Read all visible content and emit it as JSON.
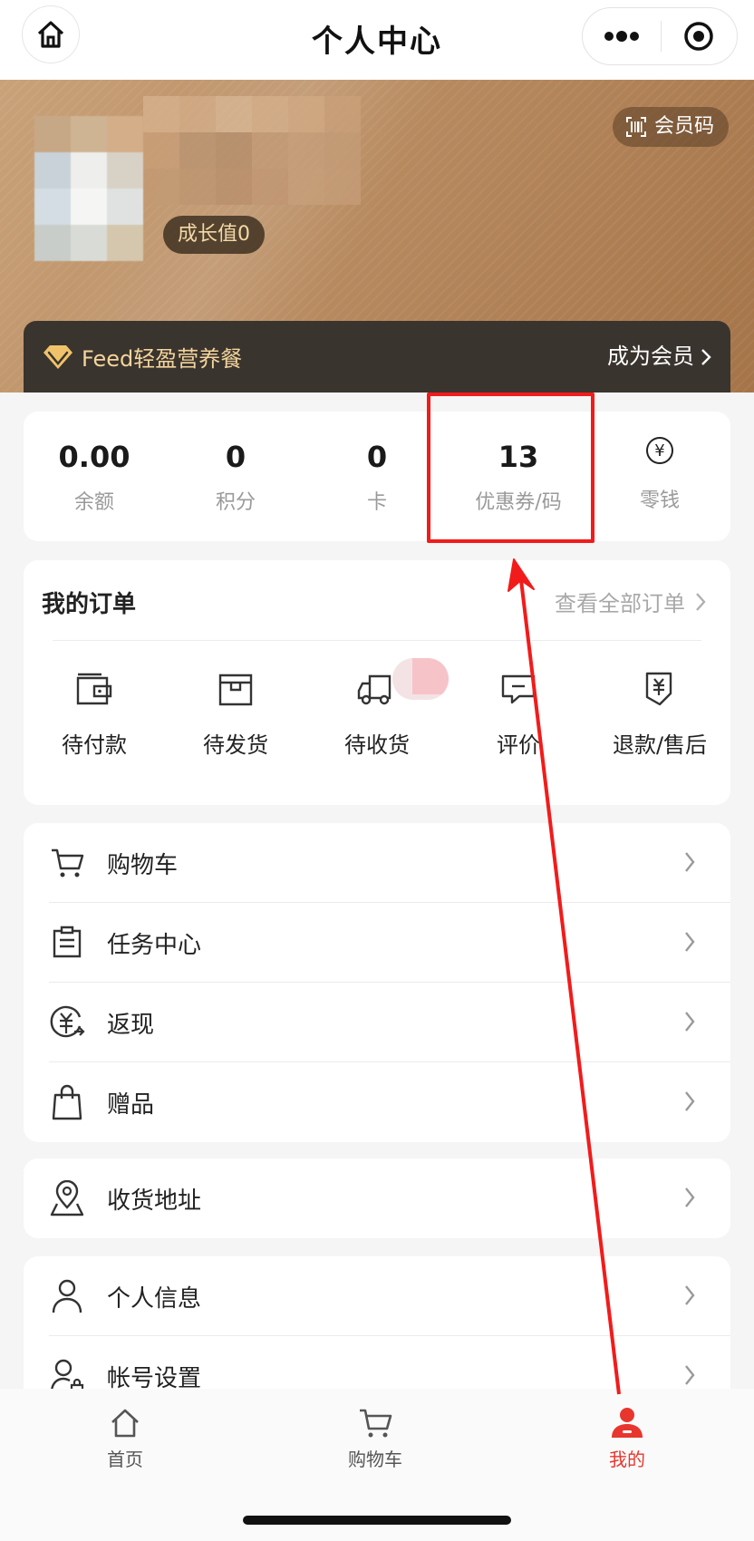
{
  "header": {
    "title": "个人中心"
  },
  "hero": {
    "growth_label": "成长值0",
    "member_code_label": "会员码",
    "vip_text": "Feed轻盈营养餐",
    "vip_join_label": "成为会员"
  },
  "stats": [
    {
      "value": "0.00",
      "label": "余额"
    },
    {
      "value": "0",
      "label": "积分"
    },
    {
      "value": "0",
      "label": "卡"
    },
    {
      "value": "13",
      "label": "优惠券/码"
    },
    {
      "icon": "yen-icon",
      "label": "零钱"
    }
  ],
  "orders": {
    "title": "我的订单",
    "view_all": "查看全部订单",
    "items": [
      {
        "label": "待付款",
        "icon": "wallet-icon"
      },
      {
        "label": "待发货",
        "icon": "box-icon"
      },
      {
        "label": "待收货",
        "icon": "truck-icon"
      },
      {
        "label": "评价",
        "icon": "comment-icon"
      },
      {
        "label": "退款/售后",
        "icon": "refund-icon"
      }
    ]
  },
  "menu_main": [
    {
      "label": "购物车",
      "icon": "cart-icon"
    },
    {
      "label": "任务中心",
      "icon": "clipboard-icon"
    },
    {
      "label": "返现",
      "icon": "cashback-icon"
    },
    {
      "label": "赠品",
      "icon": "gift-bag-icon"
    }
  ],
  "menu_address": [
    {
      "label": "收货地址",
      "icon": "location-icon"
    }
  ],
  "menu_account": [
    {
      "label": "个人信息",
      "icon": "person-icon"
    },
    {
      "label": "帐号设置",
      "icon": "account-settings-icon"
    }
  ],
  "tabbar": [
    {
      "label": "首页",
      "icon": "home-icon"
    },
    {
      "label": "购物车",
      "icon": "cart-icon"
    },
    {
      "label": "我的",
      "icon": "profile-icon",
      "active": true
    }
  ],
  "colors": {
    "accent": "#e8362e",
    "annotation_red": "#f21b1b",
    "vip_gold": "#f3d49c",
    "hero_tan": "#b88b60"
  }
}
